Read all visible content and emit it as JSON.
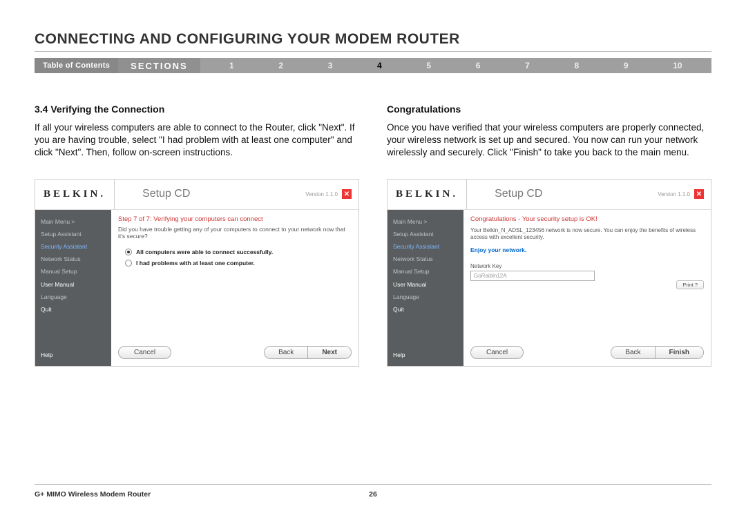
{
  "page_title": "CONNECTING AND CONFIGURING YOUR MODEM ROUTER",
  "nav": {
    "toc": "Table of Contents",
    "sections_label": "SECTIONS",
    "numbers": [
      "1",
      "2",
      "3",
      "4",
      "5",
      "6",
      "7",
      "8",
      "9",
      "10"
    ],
    "active_index": 3
  },
  "left": {
    "heading": "3.4 Verifying the Connection",
    "body": "If all your wireless computers are able to connect to the Router, click \"Next\". If you are having trouble, select \"I had problem with at least one computer\" and click \"Next\". Then, follow on-screen instructions.",
    "card": {
      "logo": "BELKIN.",
      "title": "Setup CD",
      "version": "Version 1.1.0",
      "sidebar": {
        "items": [
          {
            "label": "Main Menu  >",
            "cls": ""
          },
          {
            "label": "Setup Assistant",
            "cls": ""
          },
          {
            "label": "Security Assistant",
            "cls": "sel"
          },
          {
            "label": "Network Status",
            "cls": ""
          },
          {
            "label": "Manual Setup",
            "cls": ""
          },
          {
            "label": "User Manual",
            "cls": "bright"
          },
          {
            "label": "Language",
            "cls": ""
          },
          {
            "label": "Quit",
            "cls": "bright"
          }
        ],
        "help": "Help"
      },
      "step_title": "Step 7 of 7: Verifying your computers can connect",
      "step_sub": "Did you have trouble getting any of your computers to connect to your network now that it's secure?",
      "radios": [
        {
          "label": "All computers were able to connect successfully.",
          "selected": true
        },
        {
          "label": "I had problems with at least one computer.",
          "selected": false
        }
      ],
      "cancel": "Cancel",
      "back": "Back",
      "next": "Next"
    }
  },
  "right": {
    "heading": "Congratulations",
    "body": "Once you have verified that your wireless computers are properly connected, your wireless network is set up and secured. You now can run your network wirelessly and securely. Click \"Finish\" to take you back to the main menu.",
    "card": {
      "logo": "BELKIN.",
      "title": "Setup CD",
      "version": "Version 1.1.0",
      "sidebar": {
        "items": [
          {
            "label": "Main Menu  >",
            "cls": ""
          },
          {
            "label": "Setup Assistant",
            "cls": ""
          },
          {
            "label": "Security Assistant",
            "cls": "sel"
          },
          {
            "label": "Network Status",
            "cls": ""
          },
          {
            "label": "Manual Setup",
            "cls": ""
          },
          {
            "label": "User Manual",
            "cls": "bright"
          },
          {
            "label": "Language",
            "cls": ""
          },
          {
            "label": "Quit",
            "cls": "bright"
          }
        ],
        "help": "Help"
      },
      "congrats_title": "Congratulations - Your security setup is OK!",
      "congrats_desc": "Your Belkin_N_ADSL_123456 network is now secure. You can enjoy the benefits of wireless access with excellent security.",
      "enjoy": "Enjoy your network.",
      "nk_label": "Network Key",
      "nk_value": "GoRaibln12A",
      "print": "Print ?",
      "cancel": "Cancel",
      "back": "Back",
      "finish": "Finish"
    }
  },
  "footer": {
    "product": "G+ MIMO Wireless Modem Router",
    "page": "26"
  }
}
